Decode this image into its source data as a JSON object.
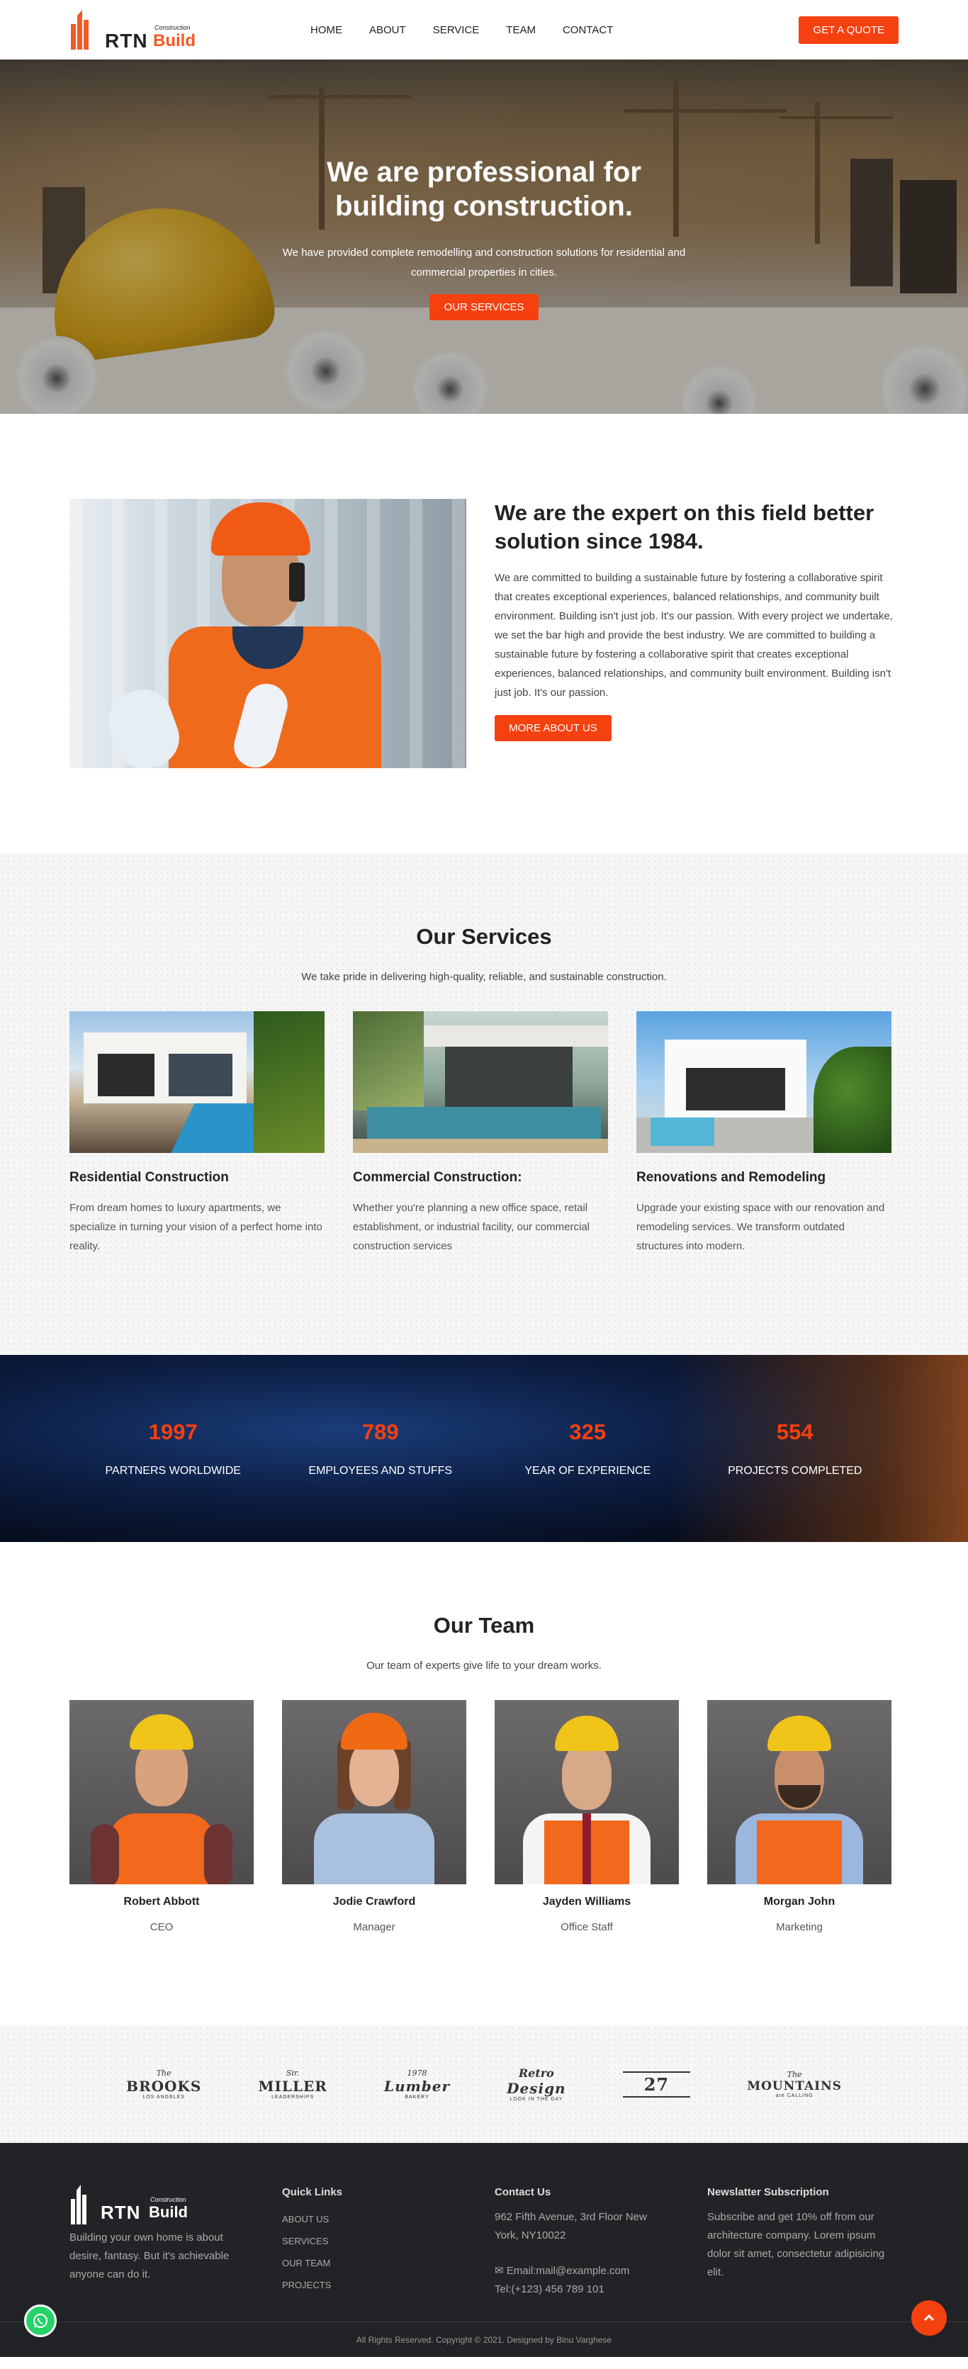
{
  "header": {
    "logo": {
      "small": "Construction",
      "rtn": "RTN",
      "build": "Build"
    },
    "nav": [
      "HOME",
      "ABOUT",
      "SERVICE",
      "TEAM",
      "CONTACT"
    ],
    "quote_button": "GET A QUOTE"
  },
  "hero": {
    "title": "We are professional for building construction.",
    "text": "We have provided complete remodelling and construction solutions for residential and commercial properties in cities.",
    "button": "OUR SERVICES"
  },
  "about": {
    "title": "We are the expert on this field better solution since 1984.",
    "text": "We are committed to building a sustainable future by fostering a collaborative spirit that creates exceptional experiences, balanced relationships, and community built environment. Building isn't just job. It's our passion. With every project we undertake, we set the bar high and provide the best industry. We are committed to building a sustainable future by fostering a collaborative spirit that creates exceptional experiences, balanced relationships, and community built environment. Building isn't just job. It's our passion.",
    "button": "MORE ABOUT US"
  },
  "services": {
    "title": "Our Services",
    "subtitle": "We take pride in delivering high-quality, reliable, and sustainable construction.",
    "items": [
      {
        "title": "Residential Construction",
        "text": "From dream homes to luxury apartments, we specialize in turning your vision of a perfect home into reality."
      },
      {
        "title": "Commercial Construction:",
        "text": "Whether you're planning a new office space, retail establishment, or industrial facility, our commercial construction services"
      },
      {
        "title": "Renovations and Remodeling",
        "text": "Upgrade your existing space with our renovation and remodeling services. We transform outdated structures into modern."
      }
    ]
  },
  "counters": [
    {
      "num": "1997",
      "label": "PARTNERS WORLDWIDE"
    },
    {
      "num": "789",
      "label": "EMPLOYEES AND STUFFS"
    },
    {
      "num": "325",
      "label": "YEAR OF EXPERIENCE"
    },
    {
      "num": "554",
      "label": "PROJECTS COMPLETED"
    }
  ],
  "team": {
    "title": "Our Team",
    "subtitle": "Our team of experts give life to your dream works.",
    "members": [
      {
        "name": "Robert Abbott",
        "role": "CEO"
      },
      {
        "name": "Jodie Crawford",
        "role": "Manager"
      },
      {
        "name": "Jayden Williams",
        "role": "Office Staff"
      },
      {
        "name": "Morgan John",
        "role": "Marketing"
      }
    ]
  },
  "clients": [
    {
      "top": "The",
      "main": "BROOKS",
      "sub": "LOS ANGELES"
    },
    {
      "top": "Sir.",
      "main": "MILLER",
      "sub": "LEADERSHIPS"
    },
    {
      "top": "1978",
      "main": "Lumber",
      "sub": "BAKERY"
    },
    {
      "top": "Retro",
      "main": "Design",
      "sub": "LOOK IN THE DAY"
    },
    {
      "top": "",
      "main": "27",
      "sub": ""
    },
    {
      "top": "The",
      "main": "MOUNTAINS",
      "sub": "are CALLING"
    }
  ],
  "footer": {
    "about": "Building your own home is about desire, fantasy. But it's achievable anyone can do it.",
    "quick_links": {
      "title": "Quick Links",
      "items": [
        "ABOUT US",
        "SERVICES",
        "OUR TEAM",
        "PROJECTS"
      ]
    },
    "contact": {
      "title": "Contact Us",
      "address": "962 Fifth Avenue, 3rd Floor New York, NY10022",
      "email": "Email:mail@example.com",
      "phone": "Tel:(+123) 456 789 101"
    },
    "newsletter": {
      "title": "Newslatter Subscription",
      "text": "Subscribe and get 10% off from our architecture company. Lorem ipsum dolor sit amet, consectetur adipisicing elit."
    },
    "copyright": "All Rights Reserved. Copyright © 2021. Designed by Binu Varghese"
  },
  "colors": {
    "accent": "#f5400f",
    "footer_bg": "#222326",
    "dark_section": "#0d1f45"
  },
  "icons": [
    "logo-building-icon",
    "whatsapp-icon",
    "arrow-up-icon",
    "email-icon"
  ]
}
